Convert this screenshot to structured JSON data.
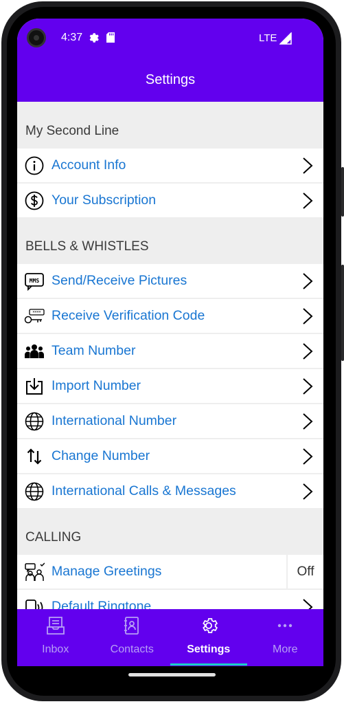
{
  "status_bar": {
    "time": "4:37",
    "network": "LTE"
  },
  "app_bar": {
    "title": "Settings"
  },
  "sections": [
    {
      "header": "My Second Line",
      "items": [
        {
          "label": "Account Info",
          "icon": "info-icon"
        },
        {
          "label": "Your Subscription",
          "icon": "dollar-icon"
        }
      ]
    },
    {
      "header": "BELLS & WHISTLES",
      "items": [
        {
          "label": "Send/Receive Pictures",
          "icon": "mms-icon"
        },
        {
          "label": "Receive Verification Code",
          "icon": "key-code-icon"
        },
        {
          "label": "Team Number",
          "icon": "team-icon"
        },
        {
          "label": "Import Number",
          "icon": "import-icon"
        },
        {
          "label": "International Number",
          "icon": "globe-icon"
        },
        {
          "label": "Change Number",
          "icon": "swap-arrows-icon"
        },
        {
          "label": "International Calls & Messages",
          "icon": "globe-icon"
        }
      ]
    },
    {
      "header": "CALLING",
      "items": [
        {
          "label": "Manage Greetings",
          "icon": "greeting-icon",
          "value": "Off"
        },
        {
          "label": "Default Ringtone",
          "icon": "ringtone-icon"
        }
      ]
    }
  ],
  "bottom_nav": [
    {
      "label": "Inbox",
      "icon": "inbox-icon",
      "active": false
    },
    {
      "label": "Contacts",
      "icon": "contacts-icon",
      "active": false
    },
    {
      "label": "Settings",
      "icon": "gear-icon",
      "active": true
    },
    {
      "label": "More",
      "icon": "more-icon",
      "active": false
    }
  ],
  "colors": {
    "primary": "#6200ee",
    "link": "#1976d2",
    "nav_indicator": "#1bd0c8",
    "inactive_nav": "#b79ff5"
  }
}
